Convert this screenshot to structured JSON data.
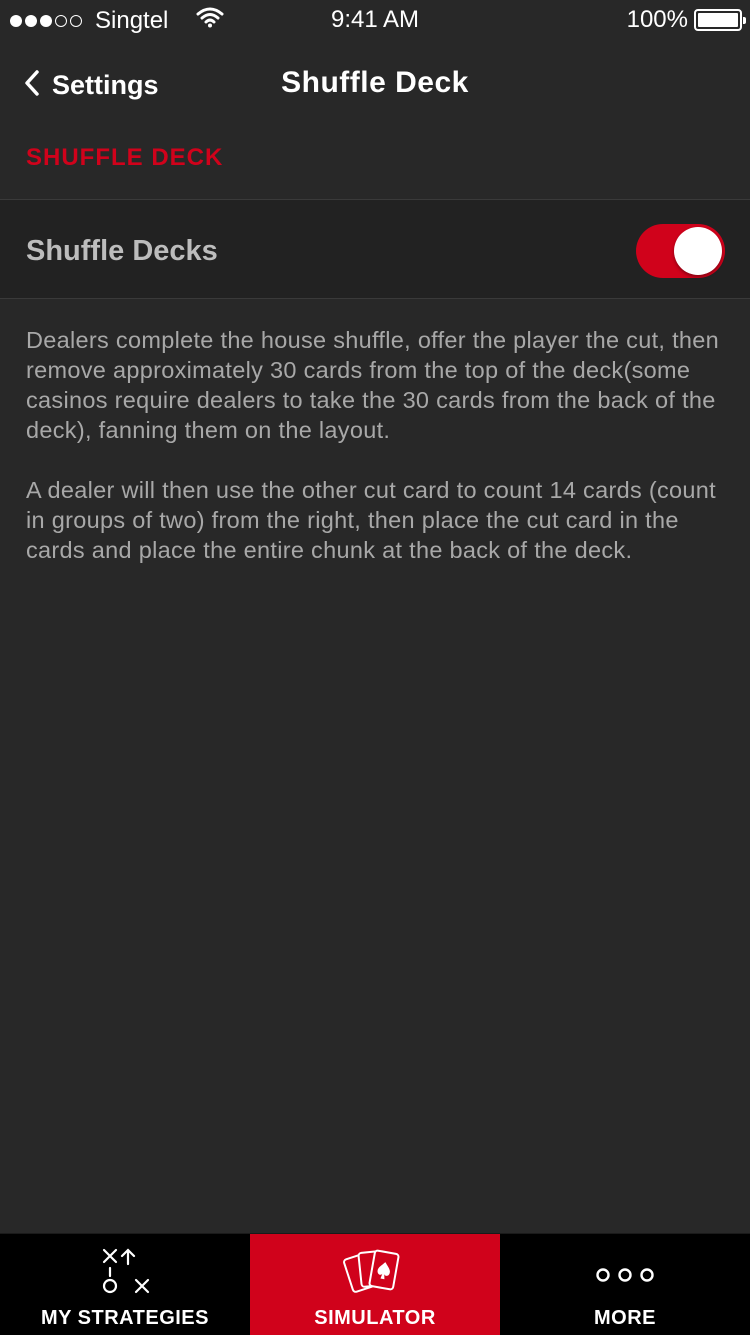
{
  "status_bar": {
    "carrier": "Singtel",
    "time": "9:41 AM",
    "battery": "100%",
    "signal_bars_filled": 3,
    "signal_bars_total": 5
  },
  "nav": {
    "back_label": "Settings",
    "title": "Shuffle Deck"
  },
  "section_header": "SHUFFLE DECK",
  "toggle_row": {
    "label": "Shuffle Decks",
    "on": true
  },
  "description": {
    "paragraph1": "Dealers complete the house shuffle, offer the player the cut, then remove approximately 30 cards from the top of the deck(some casinos require dealers to take the 30 cards from the back of the deck), fanning them on the layout.",
    "paragraph2": "A dealer will then use the other cut card to count 14 cards (count in groups of two) from the right, then place the cut card in the cards and place the entire chunk at the back of the deck."
  },
  "tabs": [
    {
      "label": "MY STRATEGIES",
      "icon": "strategy-play-icon",
      "active": false
    },
    {
      "label": "SIMULATOR",
      "icon": "playing-cards-icon",
      "active": true
    },
    {
      "label": "MORE",
      "icon": "more-dots-icon",
      "active": false
    }
  ],
  "colors": {
    "accent": "#d0021b",
    "background": "#282828",
    "row_background": "#222222",
    "tabbar_background": "#000000"
  }
}
